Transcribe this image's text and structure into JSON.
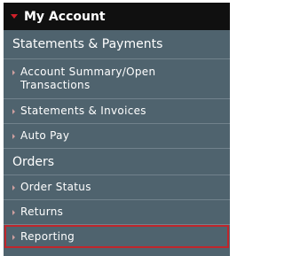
{
  "menu": {
    "header": "My Account",
    "sections": [
      {
        "title": "Statements & Payments",
        "items": [
          {
            "label": "Account Summary/Open Transactions"
          },
          {
            "label": "Statements & Invoices"
          },
          {
            "label": "Auto Pay"
          }
        ]
      },
      {
        "title": "Orders",
        "items": [
          {
            "label": "Order Status"
          },
          {
            "label": "Returns"
          },
          {
            "label": "Reporting"
          }
        ]
      }
    ]
  },
  "colors": {
    "menu_bg": "#4f636e",
    "header_bg": "#101010",
    "accent": "#d0202a",
    "highlight_border": "#c0262c"
  }
}
